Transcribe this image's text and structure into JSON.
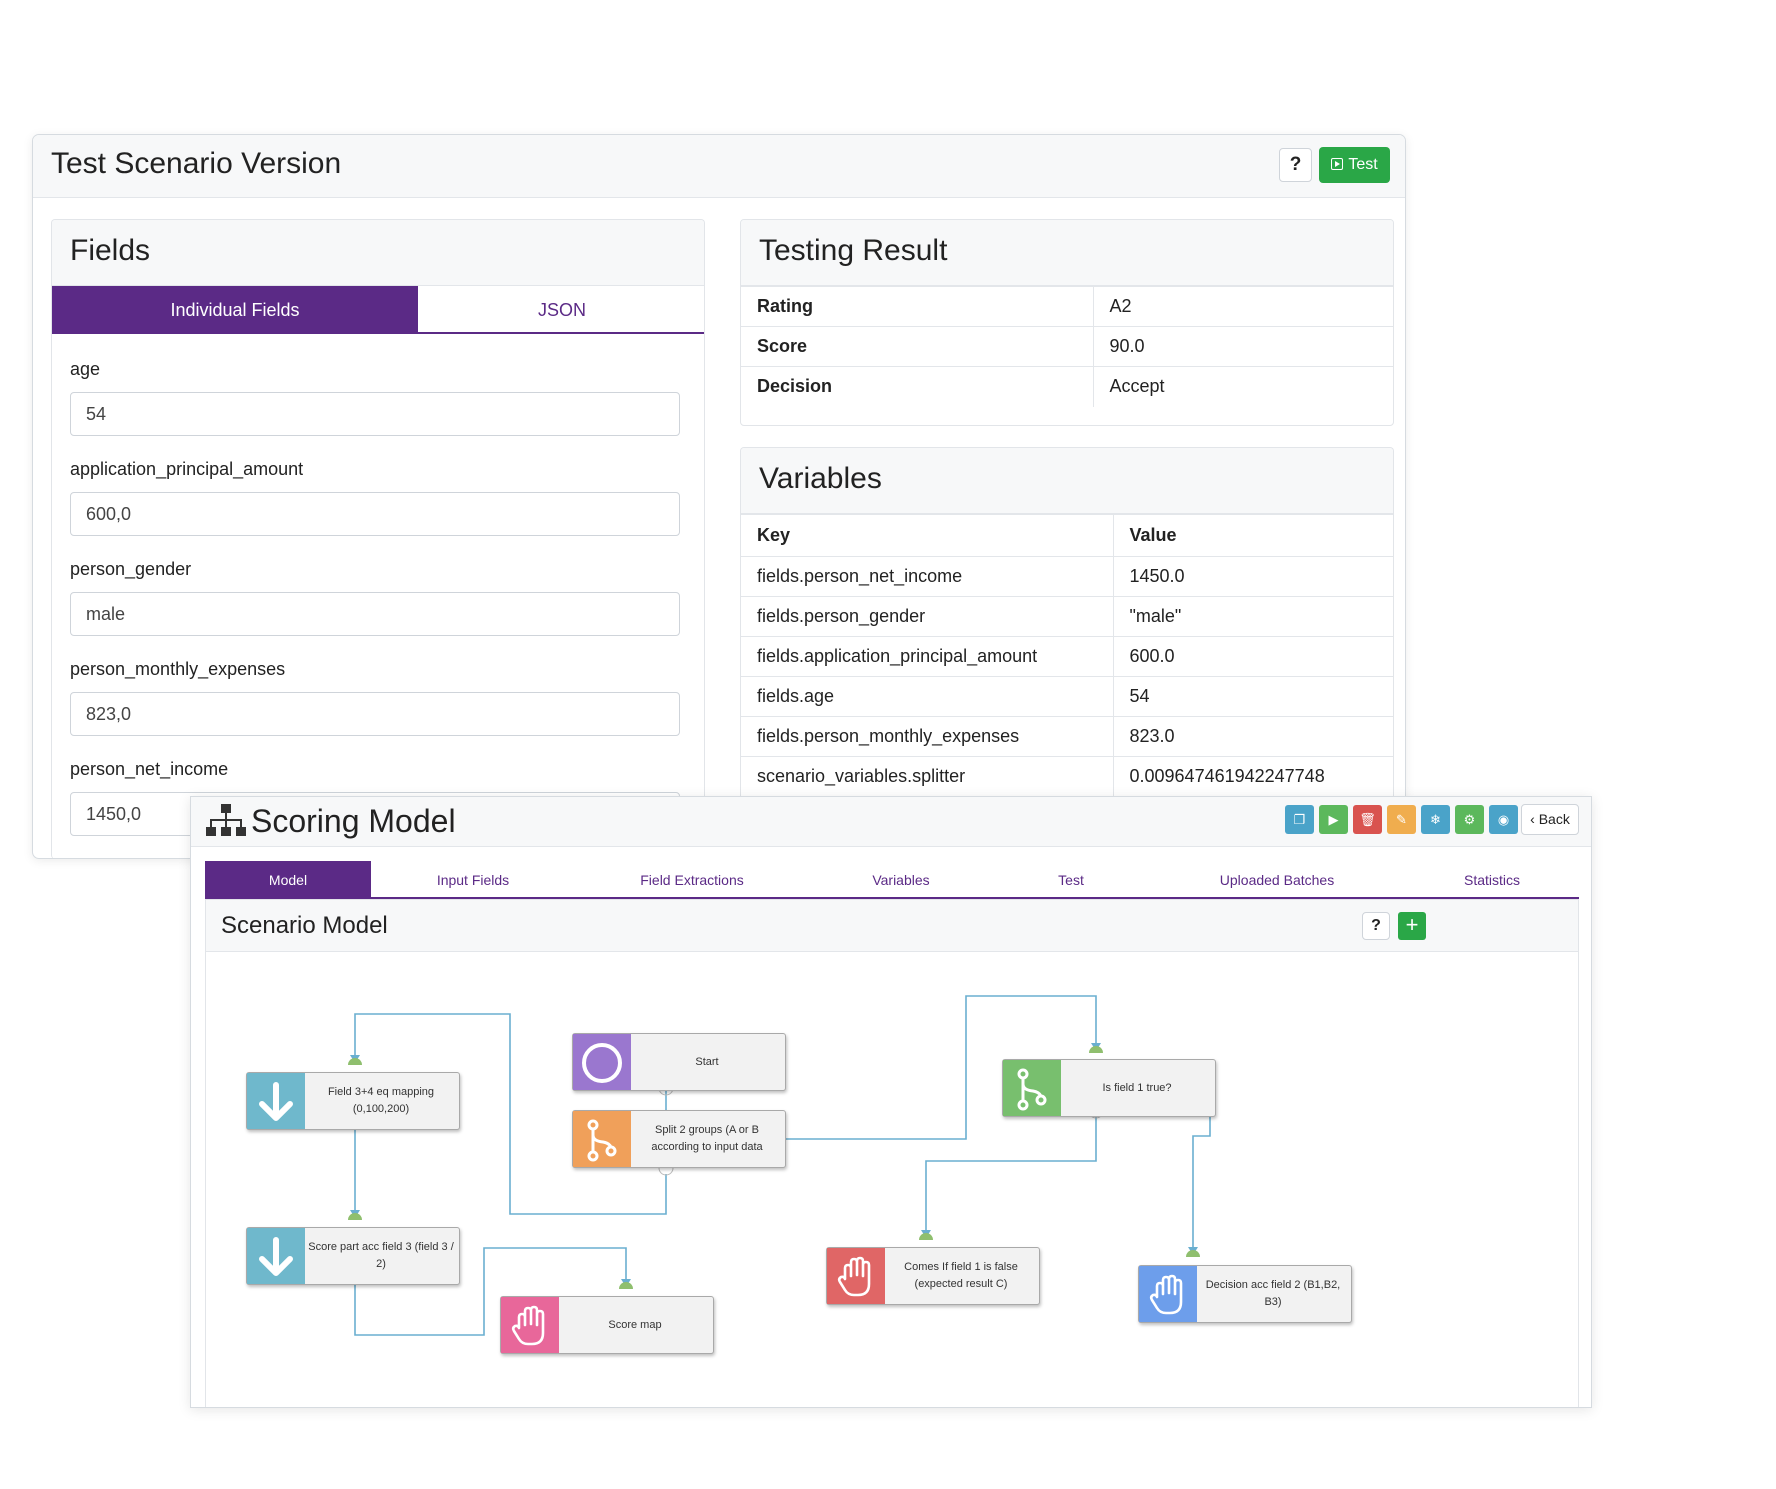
{
  "test_scenario": {
    "title": "Test Scenario Version",
    "help_label": "?",
    "test_button_label": "Test",
    "fields": {
      "title": "Fields",
      "tabs": [
        "Individual Fields",
        "JSON"
      ],
      "items": [
        {
          "label": "age",
          "value": "54"
        },
        {
          "label": "application_principal_amount",
          "value": "600,0"
        },
        {
          "label": "person_gender",
          "value": "male"
        },
        {
          "label": "person_monthly_expenses",
          "value": "823,0"
        },
        {
          "label": "person_net_income",
          "value": "1450,0"
        }
      ]
    },
    "testing_result": {
      "title": "Testing Result",
      "rows": [
        {
          "label": "Rating",
          "value": "A2"
        },
        {
          "label": "Score",
          "value": "90.0"
        },
        {
          "label": "Decision",
          "value": "Accept"
        }
      ]
    },
    "variables": {
      "title": "Variables",
      "headers": [
        "Key",
        "Value"
      ],
      "rows": [
        {
          "key": "fields.person_net_income",
          "value": "1450.0"
        },
        {
          "key": "fields.person_gender",
          "value": "\"male\""
        },
        {
          "key": "fields.application_principal_amount",
          "value": "600.0"
        },
        {
          "key": "fields.age",
          "value": "54"
        },
        {
          "key": "fields.person_monthly_expenses",
          "value": "823.0"
        },
        {
          "key": "scenario_variables.splitter",
          "value": "0.009647461942247748"
        }
      ]
    }
  },
  "scoring_model": {
    "title": "Scoring Model",
    "back_label": "Back",
    "toolbar_icons": [
      "copy-icon",
      "play-icon",
      "trash-icon",
      "edit-icon",
      "snowflake-icon",
      "cog-icon",
      "eye-icon"
    ],
    "toolbar_colors": [
      "#4aa3c9",
      "#5cb85c",
      "#d9534f",
      "#f0ad4e",
      "#4aa3c9",
      "#5cb85c",
      "#4aa3c9"
    ],
    "tabs": [
      "Model",
      "Input Fields",
      "Field Extractions",
      "Variables",
      "Test",
      "Uploaded Batches",
      "Statistics"
    ],
    "scenario": {
      "title": "Scenario Model",
      "help_label": "?",
      "add_label": "+",
      "nodes": [
        {
          "id": "start",
          "label": "Start",
          "icon": "circle-icon",
          "color": "#9a77cf"
        },
        {
          "id": "split",
          "label": "Split 2 groups (A or B according to input data",
          "icon": "branch-icon",
          "color": "#f0a05a"
        },
        {
          "id": "field34",
          "label": "Field 3+4 eq mapping (0,100,200)",
          "icon": "arrow-down-icon",
          "color": "#6fb8cc"
        },
        {
          "id": "scorepart",
          "label": "Score part acc field 3 (field 3 / 2)",
          "icon": "arrow-down-icon",
          "color": "#6fb8cc"
        },
        {
          "id": "scoremap",
          "label": "Score map",
          "icon": "hand-icon",
          "color": "#e8679a"
        },
        {
          "id": "isfield1",
          "label": "Is field 1 true?",
          "icon": "branch-icon",
          "color": "#78bf6e"
        },
        {
          "id": "comesfalse",
          "label": "Comes If field 1 is false (expected result C)",
          "icon": "hand-icon",
          "color": "#e06666"
        },
        {
          "id": "decision",
          "label": "Decision acc field 2 (B1,B2, B3)",
          "icon": "hand-icon",
          "color": "#6d9eeb"
        }
      ]
    }
  }
}
